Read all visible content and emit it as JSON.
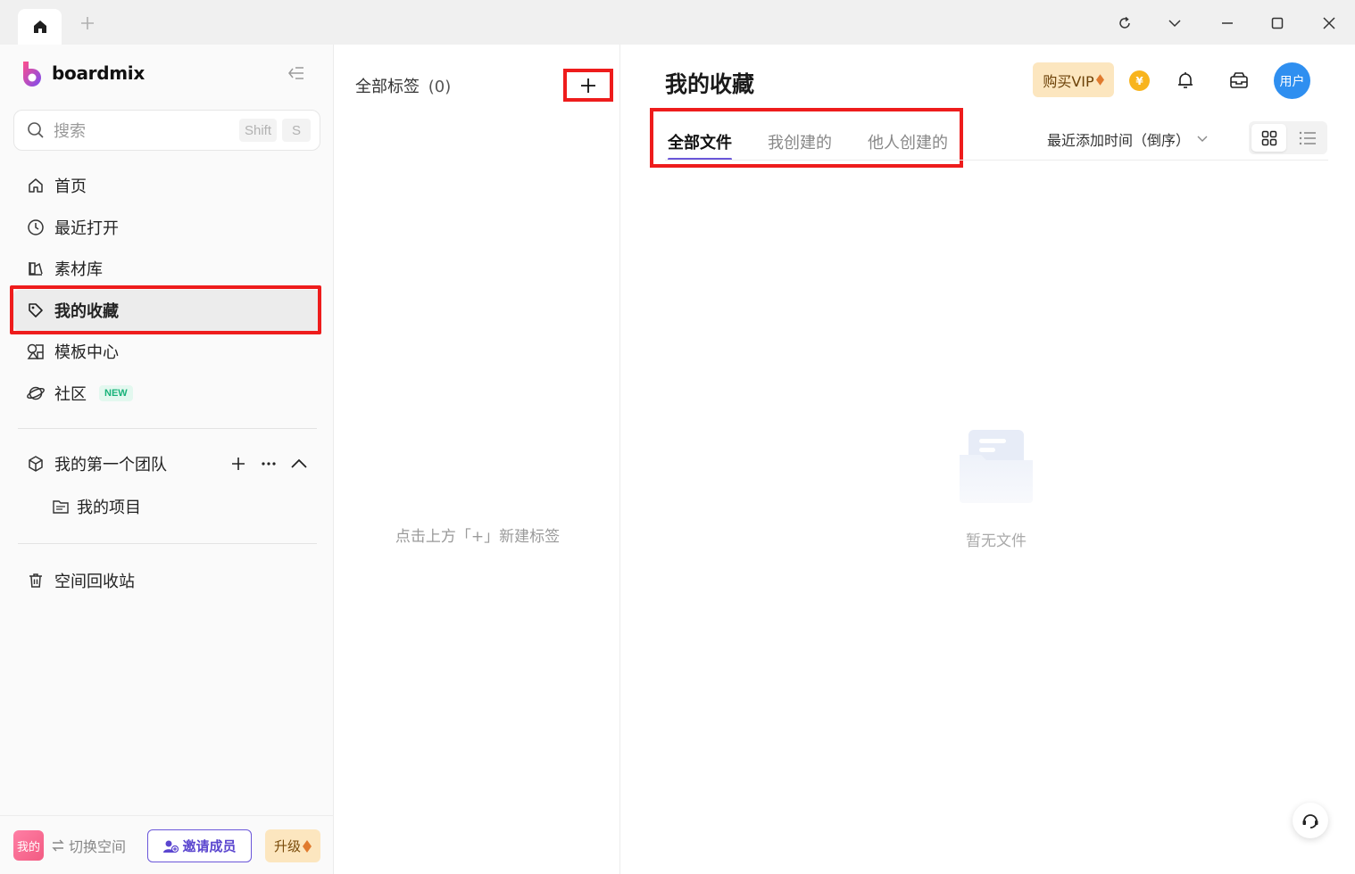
{
  "titlebar": {
    "tabs": [
      {
        "icon": "home-icon"
      }
    ],
    "new_tab_icon": "plus-icon",
    "controls": [
      "refresh-icon",
      "chevron-down-icon",
      "minimize-icon",
      "maximize-icon",
      "close-icon"
    ]
  },
  "sidebar": {
    "logo_text": "boardmix",
    "search": {
      "placeholder": "搜索",
      "shortcut_1": "Shift",
      "shortcut_2": "S"
    },
    "nav": [
      {
        "label": "首页",
        "icon": "home-icon"
      },
      {
        "label": "最近打开",
        "icon": "clock-icon"
      },
      {
        "label": "素材库",
        "icon": "material-icon"
      },
      {
        "label": "我的收藏",
        "icon": "tag-icon",
        "active": true
      },
      {
        "label": "模板中心",
        "icon": "template-icon"
      },
      {
        "label": "社区",
        "icon": "planet-icon",
        "badge": "NEW"
      }
    ],
    "team": {
      "label": "我的第一个团队",
      "icon": "cube-icon"
    },
    "project": {
      "label": "我的项目",
      "icon": "folder-icon"
    },
    "trash": {
      "label": "空间回收站",
      "icon": "trash-icon"
    },
    "bottom": {
      "avatar_text": "我的",
      "switch_label": "切换空间",
      "invite_label": "邀请成员",
      "upgrade_label": "升级"
    }
  },
  "tags_panel": {
    "title": "全部标签",
    "count": "(0)",
    "empty_hint": "点击上方「+」新建标签"
  },
  "main": {
    "title": "我的收藏",
    "vip_label": "购买VIP",
    "coin_symbol": "¥",
    "avatar_text": "用户",
    "tabs": [
      {
        "label": "全部文件",
        "active": true
      },
      {
        "label": "我创建的"
      },
      {
        "label": "他人创建的"
      }
    ],
    "sort_label": "最近添加时间（倒序）",
    "view_modes": [
      "grid-view-icon",
      "list-view-icon"
    ],
    "empty_text": "暂无文件"
  },
  "colors": {
    "accent": "#6a56d9",
    "highlight_red": "#ee1c1c",
    "vip_bg": "#fce6bf",
    "avatar_blue": "#2f8ff0"
  }
}
